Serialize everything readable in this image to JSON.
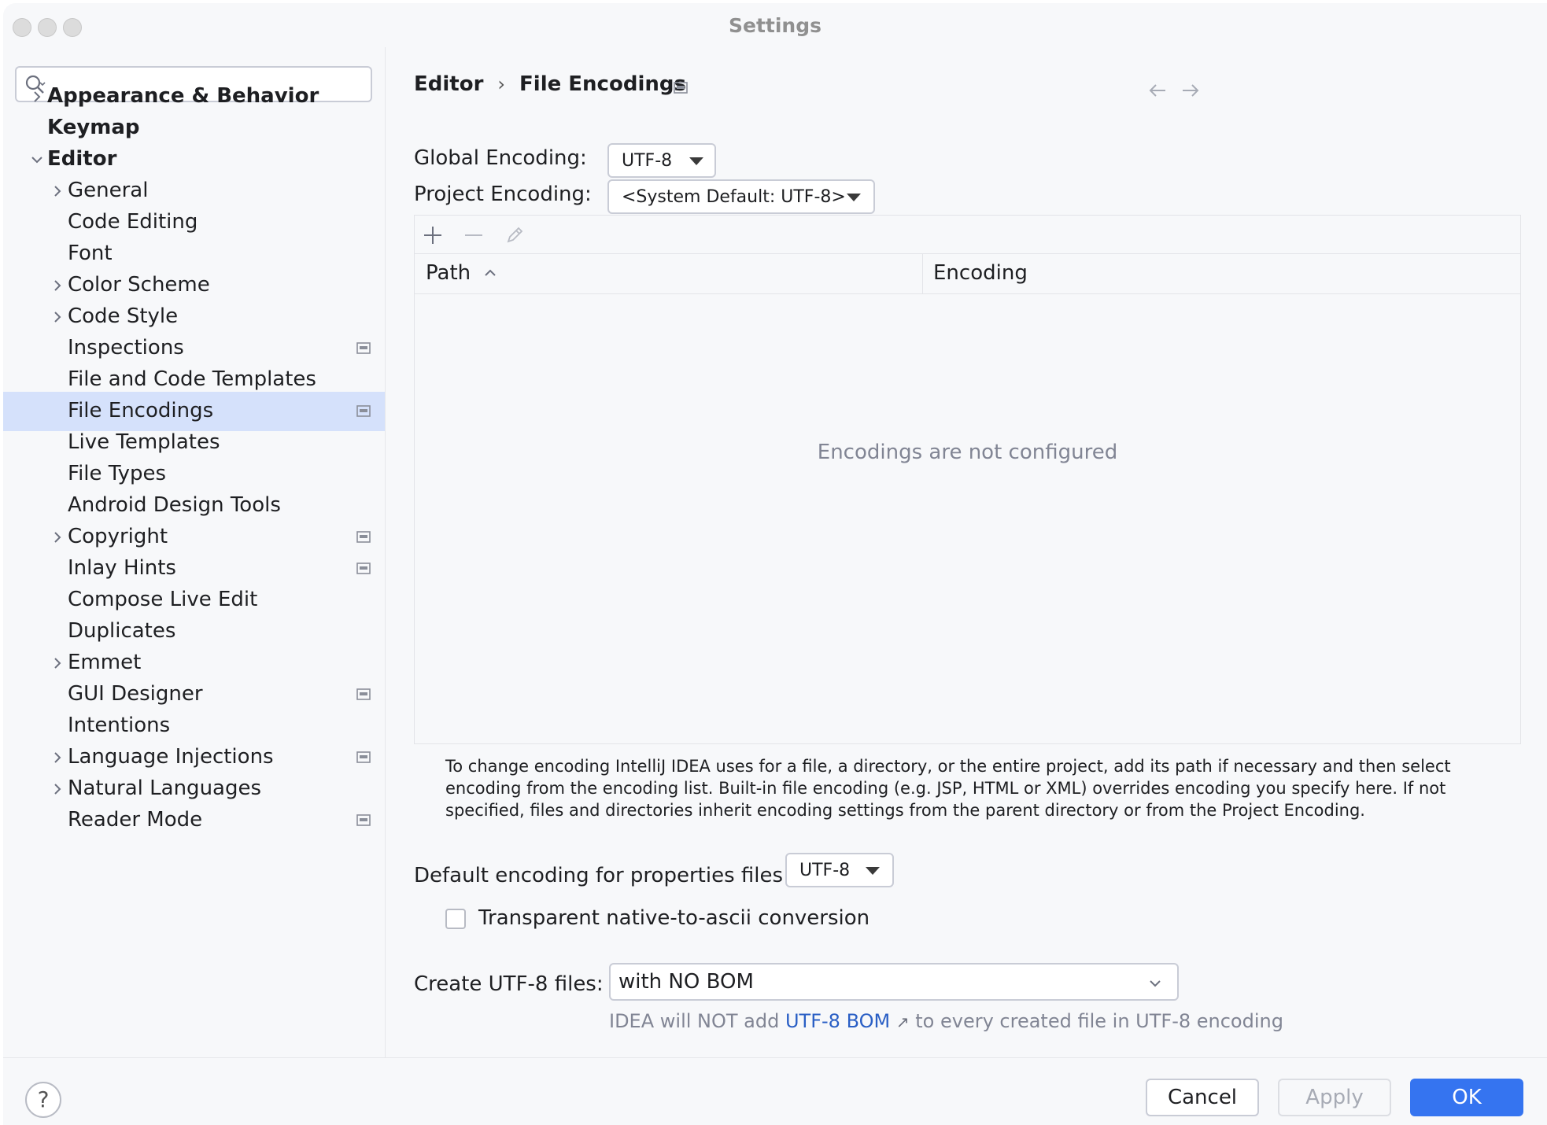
{
  "window": {
    "title": "Settings"
  },
  "sidebar": {
    "search_placeholder": "",
    "items": [
      {
        "label": "Appearance & Behavior",
        "bold": true,
        "chevron": "right",
        "level": 0
      },
      {
        "label": "Keymap",
        "bold": true,
        "chevron": "none",
        "level": 0
      },
      {
        "label": "Editor",
        "bold": true,
        "chevron": "down",
        "level": 0
      },
      {
        "label": "General",
        "chevron": "right",
        "level": 1
      },
      {
        "label": "Code Editing",
        "chevron": "none",
        "level": 1
      },
      {
        "label": "Font",
        "chevron": "none",
        "level": 1
      },
      {
        "label": "Color Scheme",
        "chevron": "right",
        "level": 1
      },
      {
        "label": "Code Style",
        "chevron": "right",
        "level": 1
      },
      {
        "label": "Inspections",
        "chevron": "none",
        "level": 1,
        "project_icon": true
      },
      {
        "label": "File and Code Templates",
        "chevron": "none",
        "level": 1
      },
      {
        "label": "File Encodings",
        "chevron": "none",
        "level": 1,
        "project_icon": true,
        "selected": true
      },
      {
        "label": "Live Templates",
        "chevron": "none",
        "level": 1
      },
      {
        "label": "File Types",
        "chevron": "none",
        "level": 1
      },
      {
        "label": "Android Design Tools",
        "chevron": "none",
        "level": 1
      },
      {
        "label": "Copyright",
        "chevron": "right",
        "level": 1,
        "project_icon": true
      },
      {
        "label": "Inlay Hints",
        "chevron": "none",
        "level": 1,
        "project_icon": true
      },
      {
        "label": "Compose Live Edit",
        "chevron": "none",
        "level": 1
      },
      {
        "label": "Duplicates",
        "chevron": "none",
        "level": 1
      },
      {
        "label": "Emmet",
        "chevron": "right",
        "level": 1
      },
      {
        "label": "GUI Designer",
        "chevron": "none",
        "level": 1,
        "project_icon": true
      },
      {
        "label": "Intentions",
        "chevron": "none",
        "level": 1
      },
      {
        "label": "Language Injections",
        "chevron": "right",
        "level": 1,
        "project_icon": true
      },
      {
        "label": "Natural Languages",
        "chevron": "right",
        "level": 1
      },
      {
        "label": "Reader Mode",
        "chevron": "none",
        "level": 1,
        "project_icon": true
      }
    ]
  },
  "main": {
    "breadcrumb": {
      "parent": "Editor",
      "separator": "›",
      "current": "File Encodings"
    },
    "global_encoding": {
      "label": "Global Encoding:",
      "value": "UTF-8"
    },
    "project_encoding": {
      "label": "Project Encoding:",
      "value": "<System Default: UTF-8>"
    },
    "table": {
      "columns": [
        "Path",
        "Encoding"
      ],
      "sort_indicator": "chevron-up-icon",
      "empty_text": "Encodings are not configured"
    },
    "help_text": "To change encoding IntelliJ IDEA uses for a file, a directory, or the entire project, add its path if necessary and then select encoding from the encoding list. Built-in file encoding (e.g. JSP, HTML or XML) overrides encoding you specify here. If not specified, files and directories inherit encoding settings from the parent directory or from the Project Encoding.",
    "properties_encoding": {
      "label": "Default encoding for properties files:",
      "value": "UTF-8"
    },
    "native_to_ascii": {
      "label": "Transparent native-to-ascii conversion",
      "checked": false
    },
    "create_utf8": {
      "label": "Create UTF-8 files:",
      "value": "with NO BOM"
    },
    "bom_note": {
      "prefix": "IDEA will NOT add",
      "link": "UTF-8 BOM",
      "link_arrow": "↗",
      "suffix": "to every created file in UTF-8 encoding"
    }
  },
  "footer": {
    "help": "?",
    "cancel": "Cancel",
    "apply": "Apply",
    "ok": "OK"
  },
  "colors": {
    "selected_row": "#d5e1fb",
    "primary_button": "#3574f0",
    "link": "#2a5fc5",
    "muted_text": "#818594"
  }
}
